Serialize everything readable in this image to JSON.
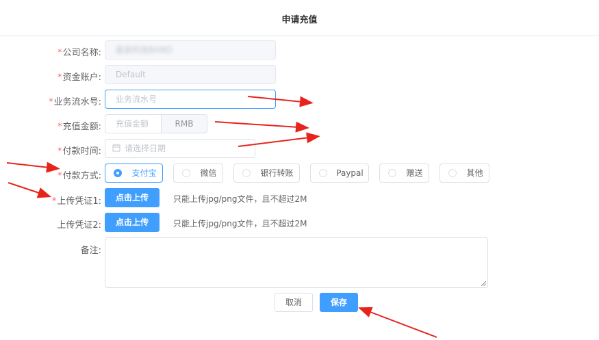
{
  "dialog": {
    "title": "申请充值"
  },
  "form": {
    "company": {
      "label": "公司名称:",
      "value": "星辰科技BAND"
    },
    "account": {
      "label": "资金账户:",
      "value": "Default"
    },
    "serial": {
      "label": "业务流水号:",
      "placeholder": "业务流水号"
    },
    "amount": {
      "label": "充值金额:",
      "placeholder": "充值金额",
      "unit": "RMB"
    },
    "pay_time": {
      "label": "付款时间:",
      "placeholder": "请选择日期"
    },
    "pay_method": {
      "label": "付款方式:",
      "options": [
        "支付宝",
        "微信",
        "银行转账",
        "Paypal",
        "赠送",
        "其他"
      ],
      "selected": "支付宝"
    },
    "upload1": {
      "label": "上传凭证1:",
      "button": "点击上传",
      "tip": "只能上传jpg/png文件，且不超过2M"
    },
    "upload2": {
      "label": "上传凭证2:",
      "button": "点击上传",
      "tip": "只能上传jpg/png文件，且不超过2M"
    },
    "remark": {
      "label": "备注:"
    },
    "required_mark": "*"
  },
  "footer": {
    "cancel": "取消",
    "save": "保存"
  },
  "colors": {
    "primary": "#409eff",
    "required": "#f56c6c",
    "annotation_arrow": "#e8231b"
  }
}
